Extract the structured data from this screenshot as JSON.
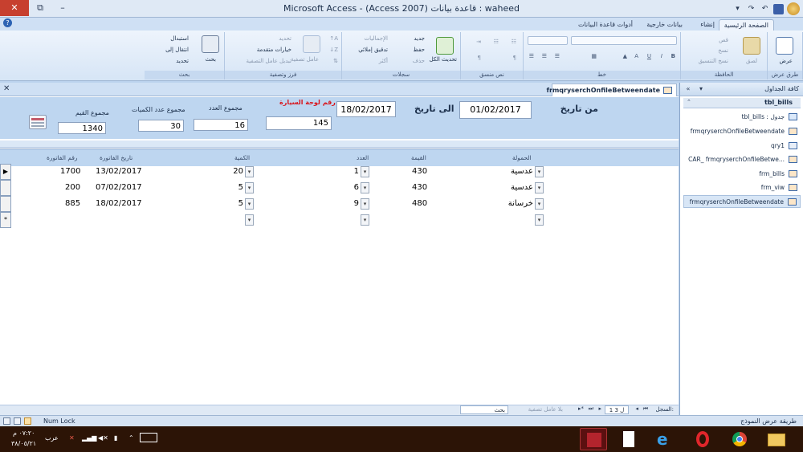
{
  "window": {
    "title": "Microsoft Access - (Access 2007) قاعدة بيانات : waheed"
  },
  "ribbon": {
    "tabs": [
      "الصفحة الرئيسية",
      "إنشاء",
      "بيانات خارجية",
      "أدوات قاعدة البيانات"
    ],
    "groups": {
      "views": {
        "label": "طرق عرض",
        "view": "عرض"
      },
      "clipboard": {
        "label": "الحافظة",
        "paste": "لصق",
        "cut": "قص",
        "copy": "نسخ",
        "format_painter": "نسخ التنسيق"
      },
      "font": {
        "label": "خط"
      },
      "rich_text": {
        "label": "نص منسق"
      },
      "records": {
        "label": "سجلات",
        "refresh": "تحديث الكل",
        "new": "جديد",
        "save": "حفظ",
        "delete": "حذف",
        "totals": "الإجماليات",
        "spelling": "تدقيق إملائي",
        "more": "أكثر"
      },
      "sort_filter": {
        "label": "فرز وتصفية",
        "filter": "عامل تصفية",
        "selection": "تحديد",
        "advanced": "خيارات متقدمة",
        "toggle_filter": "تبديل عامل التصفية"
      },
      "find": {
        "label": "بحث",
        "find": "بحث",
        "replace": "استبدال",
        "goto": "انتقال إلى",
        "select": "تحديد"
      }
    }
  },
  "nav_pane": {
    "title": "كافة الجداول",
    "group": "tbl_bills",
    "items": [
      {
        "label": "tbl_bills : جدول",
        "selected": false
      },
      {
        "label": "frmqryserchOnfileBetweendate",
        "selected": false
      },
      {
        "label": "qry1",
        "selected": false
      },
      {
        "label": "CAR_ frmqryserchOnfileBetwe...",
        "selected": false
      },
      {
        "label": "frm_bills",
        "selected": false
      },
      {
        "label": "frm_viw",
        "selected": false
      },
      {
        "label": "frmqryserchOnfileBetweendate",
        "selected": true
      }
    ]
  },
  "form": {
    "tab_title": "frmqryserchOnfileBetweendate",
    "header": {
      "from_date_label": "من تاريخ",
      "from_date": "01/02/2017",
      "to_date_label": "الى تاريخ",
      "to_date": "18/02/2017",
      "plate_label": "رقم لوحة السيارة",
      "plate_value": "145",
      "count_total_label": "مجموع العدد",
      "count_total": "16",
      "qty_total_label": "مجموع عدد الكميات",
      "qty_total": "30",
      "value_total_label": "مجموع القيم",
      "value_total": "1340"
    },
    "columns": [
      "الحمولة",
      "القيمة",
      "العدد",
      "الكمية",
      "تاريخ الفاتورة",
      "رقم الفاتورة"
    ],
    "rows": [
      {
        "selector": "▶",
        "load": "عدسية",
        "value": "430",
        "count": "1",
        "qty": "20",
        "date": "13/02/2017",
        "invoice": "1700"
      },
      {
        "selector": "",
        "load": "عدسية",
        "value": "430",
        "count": "6",
        "qty": "5",
        "date": "07/02/2017",
        "invoice": "200"
      },
      {
        "selector": "",
        "load": "خرسانة",
        "value": "480",
        "count": "9",
        "qty": "5",
        "date": "18/02/2017",
        "invoice": "885"
      },
      {
        "selector": "*",
        "load": "",
        "value": "",
        "count": "",
        "qty": "",
        "date": "",
        "invoice": ""
      }
    ]
  },
  "record_nav": {
    "label": "السجل:",
    "position": "1 ل 3",
    "filter": "بلا عامل تصفية",
    "search": "بحث"
  },
  "status": {
    "left": "طريقة عرض النموذج",
    "num_lock": "Num Lock"
  },
  "taskbar": {
    "time": "٠٧:٢٠ م",
    "date": "٣٨/٠٥/٢١",
    "lang": "عرب"
  }
}
